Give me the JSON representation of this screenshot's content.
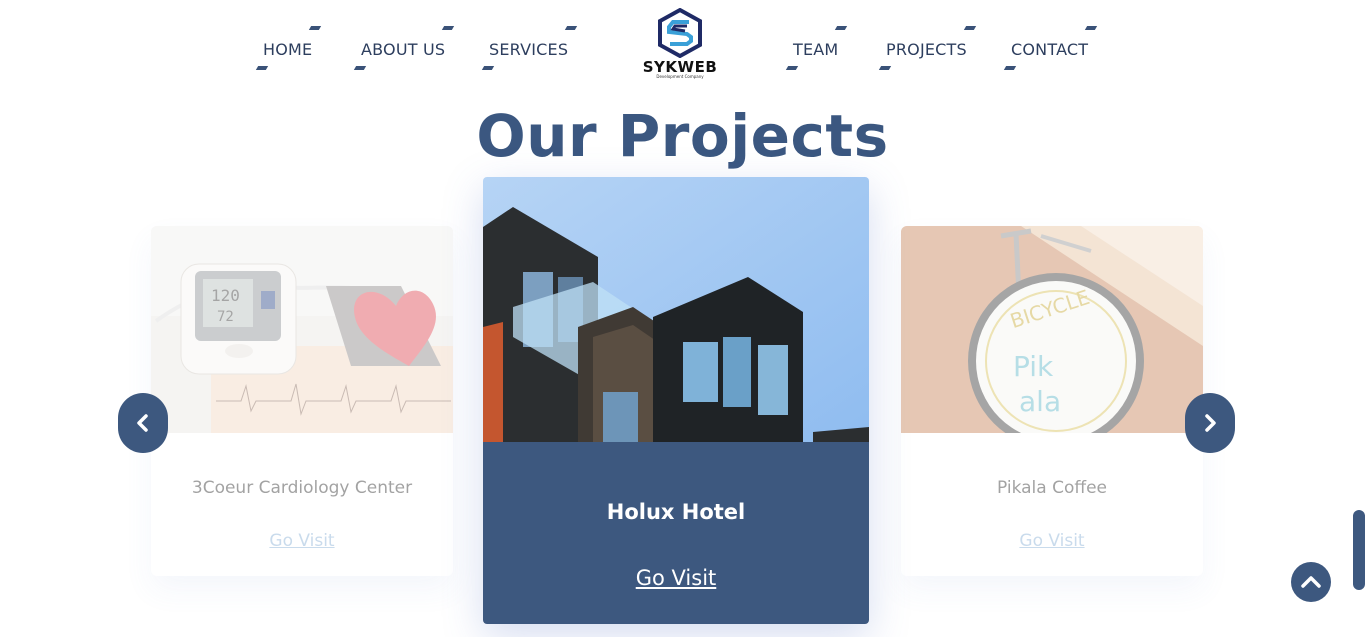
{
  "nav": {
    "left": [
      "HOME",
      "ABOUT US",
      "SERVICES"
    ],
    "right": [
      "TEAM",
      "PROJECTS",
      "CONTACT"
    ]
  },
  "logo": {
    "brand": "SYKWEB",
    "tagline": "Development Company",
    "icon": "sykweb-s-logo-icon"
  },
  "section": {
    "title": "Our Projects"
  },
  "projects": [
    {
      "name": "3Coeur Cardiology Center",
      "link": "Go Visit",
      "image": "blood-pressure-monitor-heart-image"
    },
    {
      "name": "Holux Hotel",
      "link": "Go Visit",
      "image": "modern-building-image"
    },
    {
      "name": "Pikala Coffee",
      "link": "Go Visit",
      "image": "bicycle-cafe-sign-image"
    }
  ],
  "controls": {
    "prev_icon": "chevron-left-icon",
    "next_icon": "chevron-right-icon",
    "top_icon": "chevron-up-icon"
  },
  "colors": {
    "primary": "#3d587f",
    "title": "#3b5780",
    "link_faded": "#8ab0d6"
  }
}
